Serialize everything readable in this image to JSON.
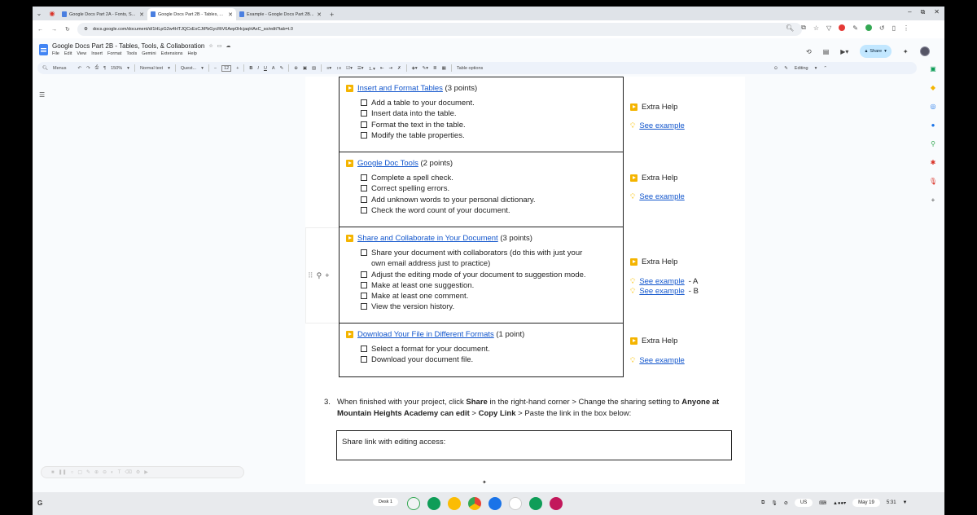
{
  "browser": {
    "tabs": [
      {
        "label": "Google Docs Part 2A - Fonts, S...",
        "active": false
      },
      {
        "label": "Google Docs Part 2B - Tables, ...",
        "active": true
      },
      {
        "label": "Example - Google Docs Part 2B...",
        "active": false
      }
    ],
    "url": "docs.google.com/document/d/1HLpG2w4HTJQCxExCJtPbGycRtV6Aep0HcjaqHAxC_so/edit?tab=t.0"
  },
  "doc": {
    "title": "Google Docs Part 2B - Tables, Tools, & Collaboration",
    "menu": [
      "File",
      "Edit",
      "View",
      "Insert",
      "Format",
      "Tools",
      "Gemini",
      "Extensions",
      "Help"
    ],
    "share_label": "Share"
  },
  "toolbar": {
    "menus_label": "Menus",
    "zoom": "150%",
    "style": "Normal text",
    "font": "Quest...",
    "font_size": "12",
    "table_options": "Table options",
    "mode": "Editing"
  },
  "tasks": [
    {
      "title": "Insert and Format Tables",
      "points": "(3 points)",
      "items": [
        "Add a table to your document.",
        "Insert data into the table.",
        "Format the text in the table.",
        "Modify the table properties."
      ],
      "help": "Extra Help",
      "examples": [
        {
          "link": "See example",
          "suffix": ""
        }
      ]
    },
    {
      "title": "Google Doc Tools",
      "points": "(2 points)",
      "items": [
        "Complete a spell check.",
        "Correct spelling errors.",
        "Add unknown words to your personal dictionary.",
        "Check the word count of your document."
      ],
      "help": "Extra Help",
      "examples": [
        {
          "link": "See example",
          "suffix": ""
        }
      ]
    },
    {
      "title": "Share and Collaborate in Your Document",
      "points": "(3 points)",
      "items": [
        "Share your document with collaborators (do this with just your",
        "own email address just to practice)",
        "Adjust the editing mode of your document to suggestion mode.",
        "Make at least one suggestion.",
        "Make at least one comment.",
        "View the version history."
      ],
      "help": "Extra Help",
      "examples": [
        {
          "link": "See example",
          "suffix": " - A"
        },
        {
          "link": "See example",
          "suffix": " - B"
        }
      ]
    },
    {
      "title": "Download Your File in Different Formats",
      "points": "(1 point)",
      "items": [
        "Select a format for your document.",
        "Download your document file."
      ],
      "help": "Extra Help",
      "examples": [
        {
          "link": "See example",
          "suffix": ""
        }
      ]
    }
  ],
  "step3": {
    "number": "3.",
    "t1": "When finished with your project, click ",
    "b1": "Share",
    "t2": " in the right-hand corner > Change the sharing setting to ",
    "b2": "Anyone at Mountain Heights Academy can edit",
    "t3": " > ",
    "b3": "Copy Link",
    "t4": " > Paste the link in the box below:"
  },
  "share_box_label": "Share link with editing access:",
  "shelf": {
    "desk": "Desk 1",
    "locale": "US",
    "date": "May 19",
    "time": "5:31"
  },
  "colors": {
    "link": "#1155cc",
    "accent": "#c2e7ff",
    "play": "#f4b400"
  }
}
